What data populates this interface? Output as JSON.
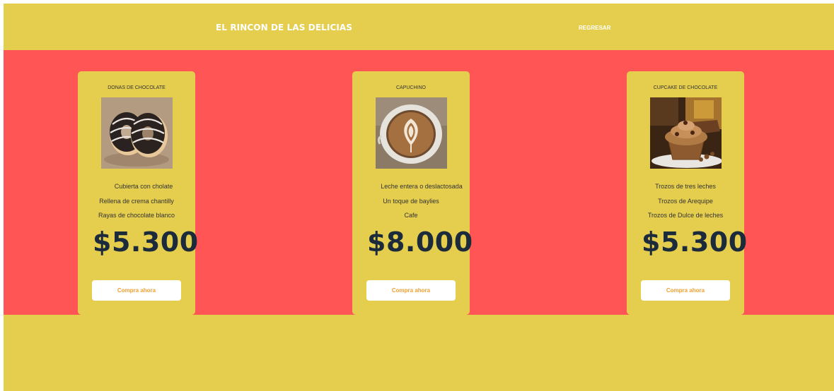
{
  "header": {
    "title": "EL RINCON DE LAS DELICIAS",
    "back_link": "REGRESAR"
  },
  "products": [
    {
      "name": "DONAS DE CHOCOLATE",
      "image_icon": "chocolate-donuts-image",
      "features": [
        "Cubierta con cholate",
        "Rellena de crema chantilly",
        "Rayas de chocolate blanco"
      ],
      "price": "$5.300",
      "button": "Compra ahora"
    },
    {
      "name": "CAPUCHINO",
      "image_icon": "cappuccino-image",
      "features": [
        "Leche entera o deslactosada",
        "Un toque de baylies",
        "Cafe"
      ],
      "price": "$8.000",
      "button": "Compra ahora"
    },
    {
      "name": "CUPCAKE DE CHOCOLATE",
      "image_icon": "chocolate-cupcake-image",
      "features": [
        "Trozos de tres leches",
        "Trozos de Arequipe",
        "Trozos de Dulce de leches"
      ],
      "price": "$5.300",
      "button": "Compra ahora"
    }
  ],
  "colors": {
    "background": "#e5cd4e",
    "band": "#ff5555",
    "price": "#1c2b3c",
    "button_text": "#f0a033"
  }
}
